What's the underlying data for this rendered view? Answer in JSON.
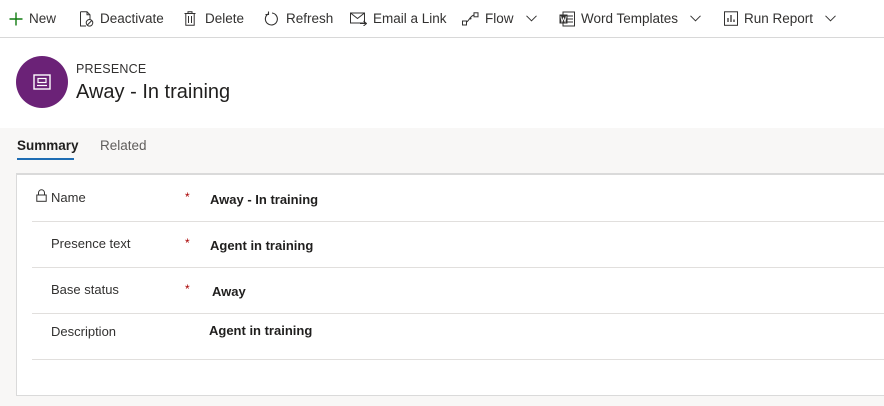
{
  "commands": {
    "new": "New",
    "deactivate": "Deactivate",
    "delete": "Delete",
    "refresh": "Refresh",
    "email_link": "Email a Link",
    "flow": "Flow",
    "word_templates": "Word Templates",
    "run_report": "Run Report"
  },
  "header": {
    "entity_type": "PRESENCE",
    "title": "Away - In training"
  },
  "tabs": {
    "summary": "Summary",
    "related": "Related"
  },
  "fields": {
    "name": {
      "label": "Name",
      "required": "*",
      "value": "Away - In training"
    },
    "presence_text": {
      "label": "Presence text",
      "required": "*",
      "value": "Agent in training"
    },
    "base_status": {
      "label": "Base status",
      "required": "*",
      "value": "Away"
    },
    "description": {
      "label": "Description",
      "value": "Agent in training"
    }
  },
  "colors": {
    "avatar": "#6b2277",
    "accent": "#1f6db3",
    "required": "#a80000",
    "new_icon": "#107c10"
  }
}
